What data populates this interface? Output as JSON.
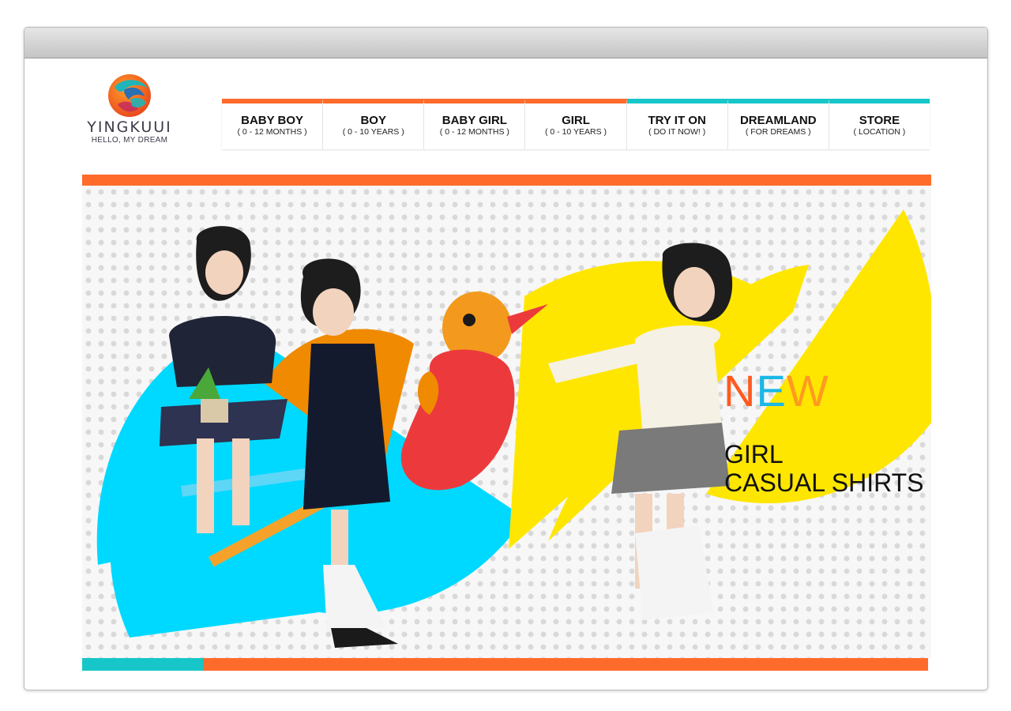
{
  "brand": {
    "name": "YINGKUUI",
    "tagline": "HELLO, MY DREAM"
  },
  "nav": [
    {
      "title": "BABY BOY",
      "sub": "( 0 - 12 MONTHS )",
      "accent": "#ff6b2b"
    },
    {
      "title": "BOY",
      "sub": "( 0 - 10 YEARS )",
      "accent": "#ff6b2b"
    },
    {
      "title": "BABY GIRL",
      "sub": "( 0 - 12 MONTHS )",
      "accent": "#ff6b2b"
    },
    {
      "title": "GIRL",
      "sub": "( 0 - 10 YEARS )",
      "accent": "#ff6b2b"
    },
    {
      "title": "TRY IT ON",
      "sub": "( DO IT NOW! )",
      "accent": "#17c6c8"
    },
    {
      "title": "DREAMLAND",
      "sub": "( FOR DREAMS )",
      "accent": "#17c6c8"
    },
    {
      "title": "STORE",
      "sub": "( LOCATION )",
      "accent": "#17c6c8"
    }
  ],
  "hero": {
    "new_letters": [
      {
        "char": "N",
        "color": "#ff5a1f"
      },
      {
        "char": "E",
        "color": "#19b8e6"
      },
      {
        "char": "W",
        "color": "#ff9a1f"
      }
    ],
    "headline_line1": "GIRL",
    "headline_line2": "CASUAL SHIRTS"
  },
  "colors": {
    "orange": "#ff6b2b",
    "teal": "#17c6c8",
    "yellow": "#ffe600",
    "cyan": "#00d9ff",
    "bird_orange": "#f39a1e",
    "bird_red": "#ec3a3c"
  }
}
